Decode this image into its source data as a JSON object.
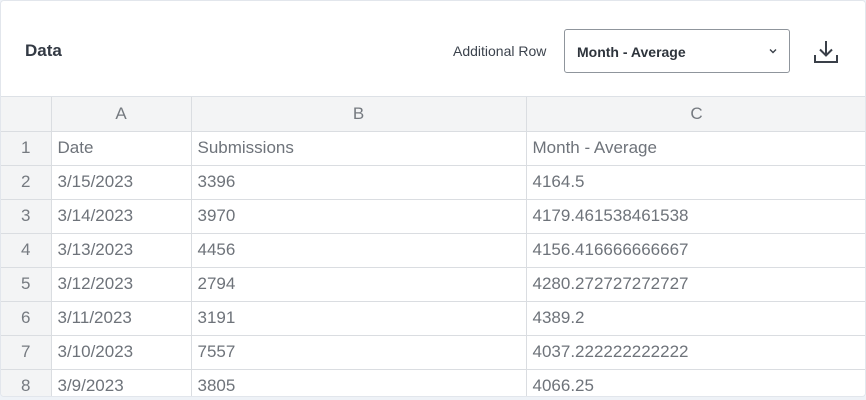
{
  "header": {
    "title": "Data",
    "additional_row_label": "Additional Row",
    "select_value": "Month - Average",
    "download_icon": "download-icon",
    "chevron_icon": "chevron-down-icon"
  },
  "grid": {
    "columns": [
      "A",
      "B",
      "C"
    ],
    "rows": [
      {
        "num": "1",
        "cells": [
          "Date",
          "Submissions",
          "Month - Average"
        ]
      },
      {
        "num": "2",
        "cells": [
          "3/15/2023",
          "3396",
          "4164.5"
        ]
      },
      {
        "num": "3",
        "cells": [
          "3/14/2023",
          "3970",
          "4179.461538461538"
        ]
      },
      {
        "num": "4",
        "cells": [
          "3/13/2023",
          "4456",
          "4156.416666666667"
        ]
      },
      {
        "num": "5",
        "cells": [
          "3/12/2023",
          "2794",
          "4280.272727272727"
        ]
      },
      {
        "num": "6",
        "cells": [
          "3/11/2023",
          "3191",
          "4389.2"
        ]
      },
      {
        "num": "7",
        "cells": [
          "3/10/2023",
          "7557",
          "4037.222222222222"
        ]
      },
      {
        "num": "8",
        "cells": [
          "3/9/2023",
          "3805",
          "4066.25"
        ]
      }
    ]
  }
}
